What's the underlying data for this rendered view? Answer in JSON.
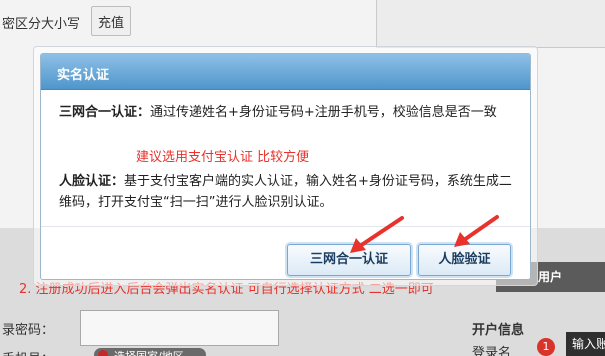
{
  "background": {
    "case_text": "密区分大小写",
    "recharge_label": "充值",
    "right_panel_title": "用户",
    "pwd_label": "录密码：",
    "cut_label": "手机号：",
    "cut_pill_text": "选择国家/地区",
    "badge_count": "1",
    "account_info_title": "开户信息",
    "login_name_label": "登录名",
    "tooltip_text": "输入账"
  },
  "modal": {
    "title": "实名认证",
    "three_label": "三网合一认证：",
    "three_text": "通过传递姓名+身份证号码+注册手机号，校验信息是否一致",
    "face_label": "人脸认证：",
    "face_text": "基于支付宝客户端的实人认证，输入姓名+身份证号码，系统生成二维码，打开支付宝“扫一扫”进行人脸识别认证。",
    "buttons": {
      "three": "三网合一认证",
      "face": "人脸验证"
    }
  },
  "annotations": {
    "note_1": "建议选用支付宝认证  比较方便",
    "note_2": "2.   注册成功后进入后台会弹出实名认证  可自行选择认证方式  二选一即可",
    "color": "#e8322b"
  },
  "colors": {
    "header_gradient_top": "#8ec0e6",
    "header_gradient_bottom": "#4f96cc",
    "button_text": "#1b3c5f"
  }
}
